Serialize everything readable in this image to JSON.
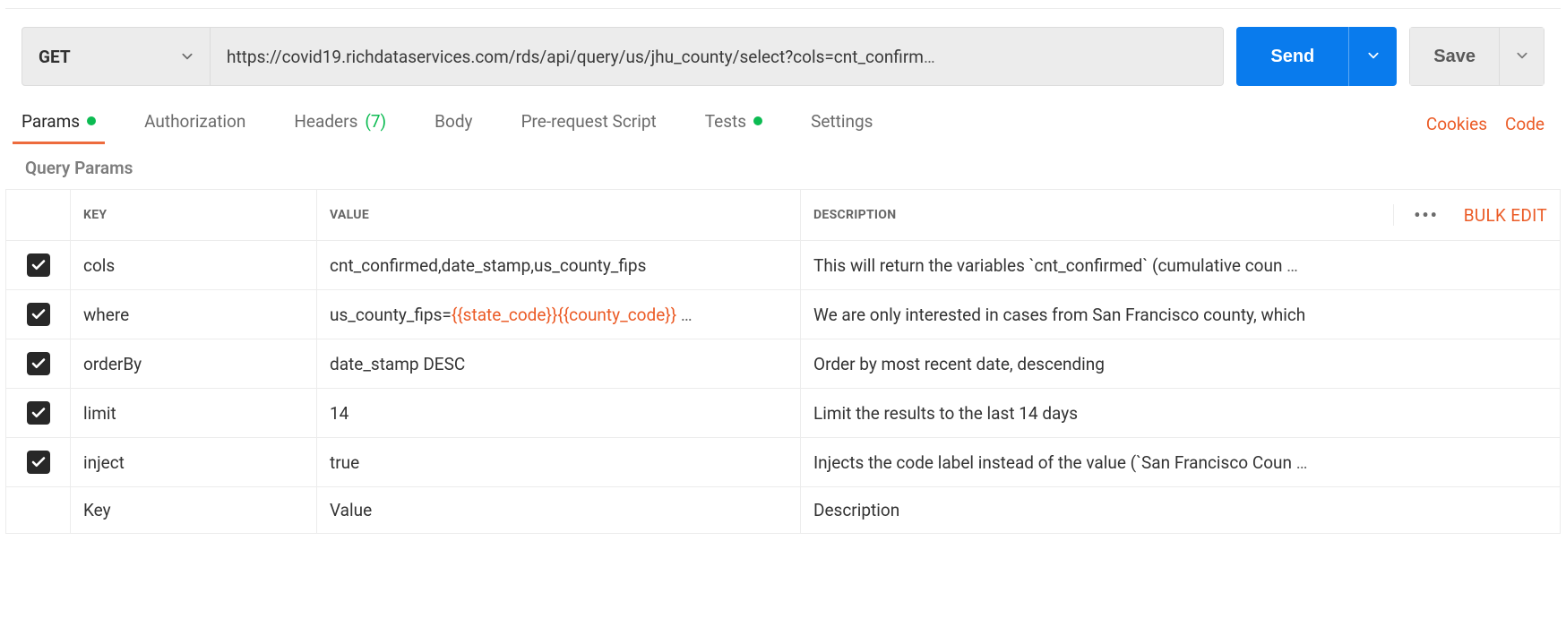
{
  "request": {
    "method": "GET",
    "url": "https://covid19.richdataservices.com/rds/api/query/us/jhu_county/select?cols=cnt_confirm",
    "url_ellipsis": "…"
  },
  "buttons": {
    "send": "Send",
    "save": "Save"
  },
  "tabs": {
    "params": "Params",
    "authorization": "Authorization",
    "headers_label": "Headers",
    "headers_count": "(7)",
    "body": "Body",
    "prerequest": "Pre-request Script",
    "tests": "Tests",
    "settings": "Settings"
  },
  "links": {
    "cookies": "Cookies",
    "code": "Code",
    "bulk_edit": "Bulk Edit"
  },
  "section": {
    "query_params": "Query Params"
  },
  "table": {
    "headers": {
      "key": "KEY",
      "value": "VALUE",
      "description": "DESCRIPTION"
    },
    "placeholders": {
      "key": "Key",
      "value": "Value",
      "description": "Description"
    },
    "ellipsis": " …",
    "rows": [
      {
        "checked": true,
        "key": "cols",
        "value_plain": "cnt_confirmed,date_stamp,us_county_fips",
        "description": "This will return the variables `cnt_confirmed` (cumulative coun"
      },
      {
        "checked": true,
        "key": "where",
        "value_prefix": "us_county_fips=",
        "value_var": "{{state_code}}{{county_code}}",
        "value_suffix": "",
        "description": "We are only interested in cases from San Francisco county, which"
      },
      {
        "checked": true,
        "key": "orderBy",
        "value_plain": "date_stamp DESC",
        "description": "Order by most recent date, descending"
      },
      {
        "checked": true,
        "key": "limit",
        "value_plain": "14",
        "description": "Limit the results to the last 14 days"
      },
      {
        "checked": true,
        "key": "inject",
        "value_plain": "true",
        "description": "Injects the code label instead of the value (`San Francisco Coun"
      }
    ]
  }
}
